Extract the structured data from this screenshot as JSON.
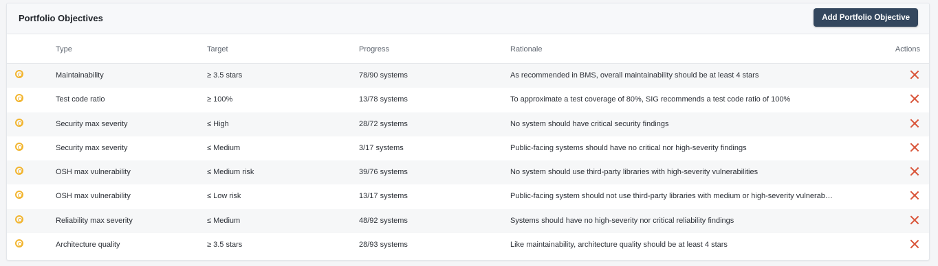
{
  "panel": {
    "title": "Portfolio Objectives",
    "add_button_label": "Add Portfolio Objective"
  },
  "columns": {
    "type": "Type",
    "target": "Target",
    "progress": "Progress",
    "rationale": "Rationale",
    "actions": "Actions"
  },
  "colors": {
    "objective_icon": "#f2b530",
    "delete_icon": "#d9553a",
    "primary_button": "#34475e"
  },
  "rows": [
    {
      "icon": "target-icon",
      "type": "Maintainability",
      "target": "≥ 3.5 stars",
      "progress": "78/90 systems",
      "rationale": "As recommended in BMS, overall maintainability should be at least 4 stars"
    },
    {
      "icon": "target-icon",
      "type": "Test code ratio",
      "target": "≥ 100%",
      "progress": "13/78 systems",
      "rationale": "To approximate a test coverage of 80%, SIG recommends a test code ratio of 100%"
    },
    {
      "icon": "target-icon",
      "type": "Security max severity",
      "target": "≤ High",
      "progress": "28/72 systems",
      "rationale": "No system should have critical security findings"
    },
    {
      "icon": "target-icon",
      "type": "Security max severity",
      "target": "≤ Medium",
      "progress": "3/17 systems",
      "rationale": "Public-facing systems should have no critical nor high-severity findings"
    },
    {
      "icon": "target-icon",
      "type": "OSH max vulnerability",
      "target": "≤ Medium risk",
      "progress": "39/76 systems",
      "rationale": "No system should use third-party libraries with high-severity vulnerabilities"
    },
    {
      "icon": "target-icon",
      "type": "OSH max vulnerability",
      "target": "≤ Low risk",
      "progress": "13/17 systems",
      "rationale": "Public-facing system should not use third-party libraries with medium or high-severity vulnerabil..."
    },
    {
      "icon": "target-icon",
      "type": "Reliability max severity",
      "target": "≤ Medium",
      "progress": "48/92 systems",
      "rationale": "Systems should have no high-severity nor critical reliability findings"
    },
    {
      "icon": "target-icon",
      "type": "Architecture quality",
      "target": "≥ 3.5 stars",
      "progress": "28/93 systems",
      "rationale": "Like maintainability, architecture quality should be at least 4 stars"
    }
  ]
}
